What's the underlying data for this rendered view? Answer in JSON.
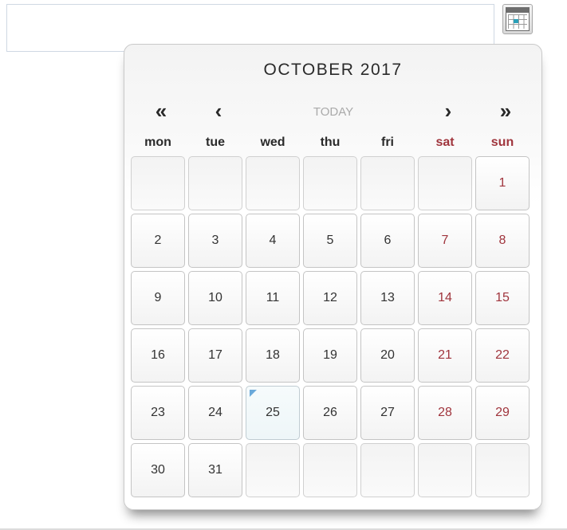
{
  "input": {
    "value": "",
    "placeholder": ""
  },
  "trigger": {
    "icon": "calendar-icon"
  },
  "calendar": {
    "title": "OCTOBER 2017",
    "nav": {
      "prev_year": "«",
      "prev_month": "‹",
      "today": "TODAY",
      "next_month": "›",
      "next_year": "»"
    },
    "weekdays": [
      "mon",
      "tue",
      "wed",
      "thu",
      "fri",
      "sat",
      "sun"
    ],
    "leading_empty": 6,
    "days": [
      "1",
      "2",
      "3",
      "4",
      "5",
      "6",
      "7",
      "8",
      "9",
      "10",
      "11",
      "12",
      "13",
      "14",
      "15",
      "16",
      "17",
      "18",
      "19",
      "20",
      "21",
      "22",
      "23",
      "24",
      "25",
      "26",
      "27",
      "28",
      "29",
      "30",
      "31"
    ],
    "today": "25",
    "total_cells": 42
  },
  "colors": {
    "weekend": "#a0353d",
    "today_marker": "#6aa9da",
    "icon_accent": "#2aa0b8"
  }
}
